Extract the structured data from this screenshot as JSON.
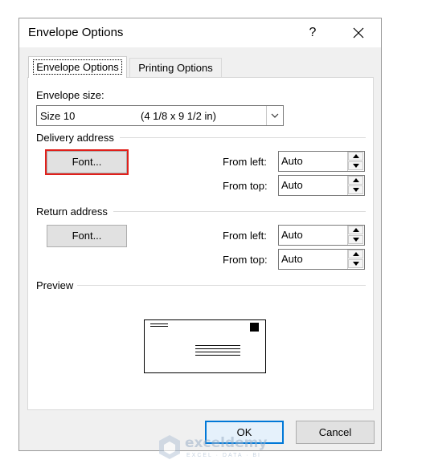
{
  "window": {
    "title": "Envelope Options",
    "help": "?"
  },
  "tabs": [
    {
      "label": "Envelope Options",
      "active": true
    },
    {
      "label": "Printing Options",
      "active": false
    }
  ],
  "envelope_size": {
    "label": "Envelope size:",
    "value_name": "Size 10",
    "value_dims": "(4 1/8 x 9 1/2 in)"
  },
  "delivery": {
    "heading": "Delivery address",
    "font_button": "Font...",
    "from_left_label": "From left:",
    "from_left_value": "Auto",
    "from_top_label": "From top:",
    "from_top_value": "Auto"
  },
  "return": {
    "heading": "Return address",
    "font_button": "Font...",
    "from_left_label": "From left:",
    "from_left_value": "Auto",
    "from_top_label": "From top:",
    "from_top_value": "Auto"
  },
  "preview": {
    "heading": "Preview"
  },
  "buttons": {
    "ok": "OK",
    "cancel": "Cancel"
  },
  "watermark": {
    "name": "exceldemy",
    "tagline": "EXCEL · DATA · BI"
  },
  "colors": {
    "highlight": "#e0201b",
    "accent": "#0078d7"
  }
}
